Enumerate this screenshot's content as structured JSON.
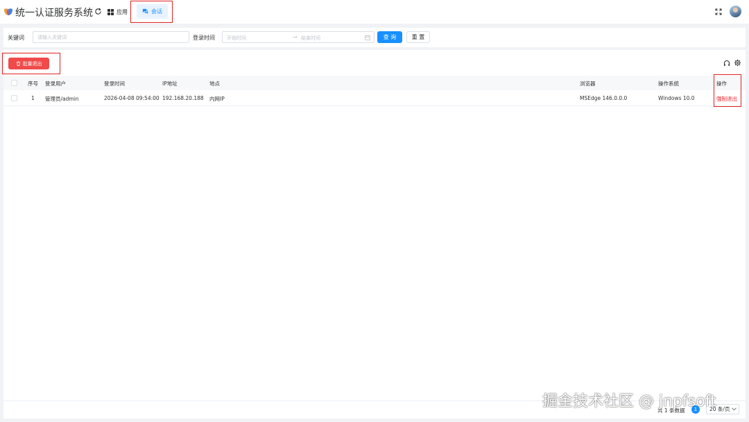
{
  "header": {
    "title": "统一认证服务系统",
    "nav": [
      {
        "label": "应用",
        "icon": "grid-icon"
      },
      {
        "label": "会话",
        "icon": "chat-icon",
        "active": true
      }
    ]
  },
  "search": {
    "keyword_label": "关键词",
    "keyword_placeholder": "请输入关键词",
    "time_label": "登录时间",
    "start_placeholder": "开始时间",
    "range_separator": "→",
    "end_placeholder": "结束时间",
    "query_button": "查 询",
    "reset_button": "重 置"
  },
  "toolbar": {
    "batch_logout": "批量退出"
  },
  "table": {
    "columns": [
      "序号",
      "登录用户",
      "登录时间",
      "IP地址",
      "地点",
      "浏览器",
      "操作系统",
      "操作"
    ],
    "rows": [
      {
        "index": "1",
        "user": "管理员/admin",
        "login_time": "2026-04-08 09:54:00",
        "ip": "192.168.20.188",
        "location": "内网IP",
        "browser": "MSEdge 146.0.0.0",
        "os": "Windows 10.0",
        "action": "强制退出"
      }
    ]
  },
  "pagination": {
    "total_text": "共 1 条数据",
    "current_page": "1",
    "page_size": "20 条/页"
  },
  "watermark": "掘金技术社区 @ jnpfsoft",
  "colors": {
    "primary": "#1890ff",
    "danger": "#f04a4a",
    "highlight": "#e02020"
  }
}
